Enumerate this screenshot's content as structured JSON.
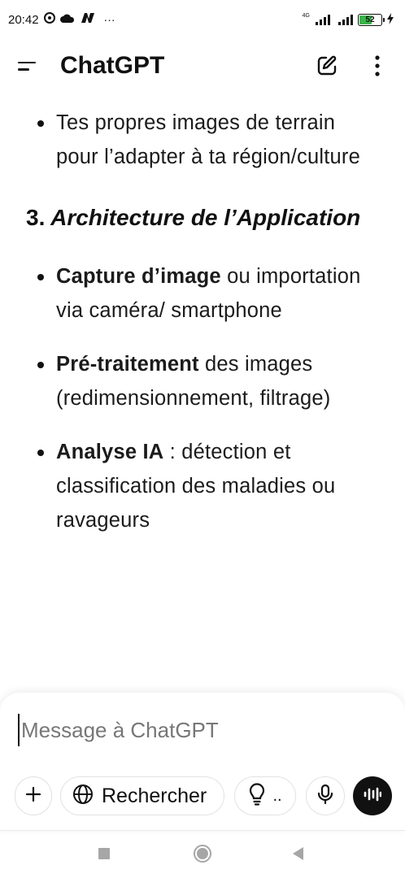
{
  "status_bar": {
    "time": "20:42",
    "network_type": "4G",
    "battery_level": "52",
    "more": "···"
  },
  "header": {
    "title": "ChatGPT"
  },
  "conversation": {
    "intro_bullet": "Tes propres images de terrain pour l’adapter à ta région/culture",
    "section_number": "3.",
    "section_title": "Architecture de l’Application",
    "items": [
      {
        "bold": "Capture d’image",
        "text": " ou importation via caméra/ smartphone"
      },
      {
        "bold": "Pré-traitement",
        "text": " des images (redimensionnement, filtrage)"
      },
      {
        "bold": "Analyse IA",
        "text": " : détection et classification des maladies ou ravageurs"
      }
    ]
  },
  "composer": {
    "placeholder": "Message à ChatGPT",
    "search_label": "Rechercher",
    "think_label": ".."
  },
  "icons": {
    "menu": "menu-icon",
    "new_chat": "new-chat-icon",
    "more": "more-vertical-icon",
    "plus": "plus-icon",
    "globe": "globe-icon",
    "lightbulb": "lightbulb-icon",
    "mic": "mic-icon",
    "voice": "voice-mode-icon"
  },
  "colors": {
    "battery_fill": "#3ab54a",
    "text": "#111111",
    "nav": "#a6a6a6"
  }
}
